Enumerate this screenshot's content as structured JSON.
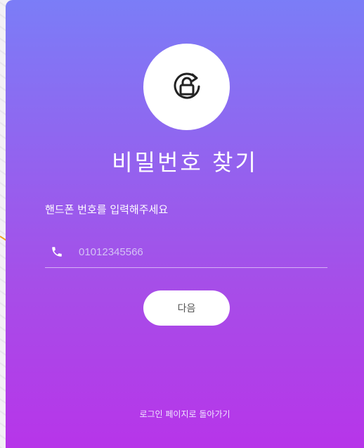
{
  "page": {
    "title": "비밀번호 찾기",
    "prompt": "핸드폰 번호를 입력해주세요"
  },
  "phone_field": {
    "icon": "phone-icon",
    "placeholder": "01012345566",
    "value": ""
  },
  "buttons": {
    "next_label": "다음"
  },
  "links": {
    "back_to_login": "로그인 페이지로 돌아가기"
  },
  "icons": {
    "header": "lock-rotate-icon"
  },
  "colors": {
    "gradient_top": "#7b7df7",
    "gradient_bottom": "#b735e9",
    "pointer_line": "#f0a020"
  }
}
